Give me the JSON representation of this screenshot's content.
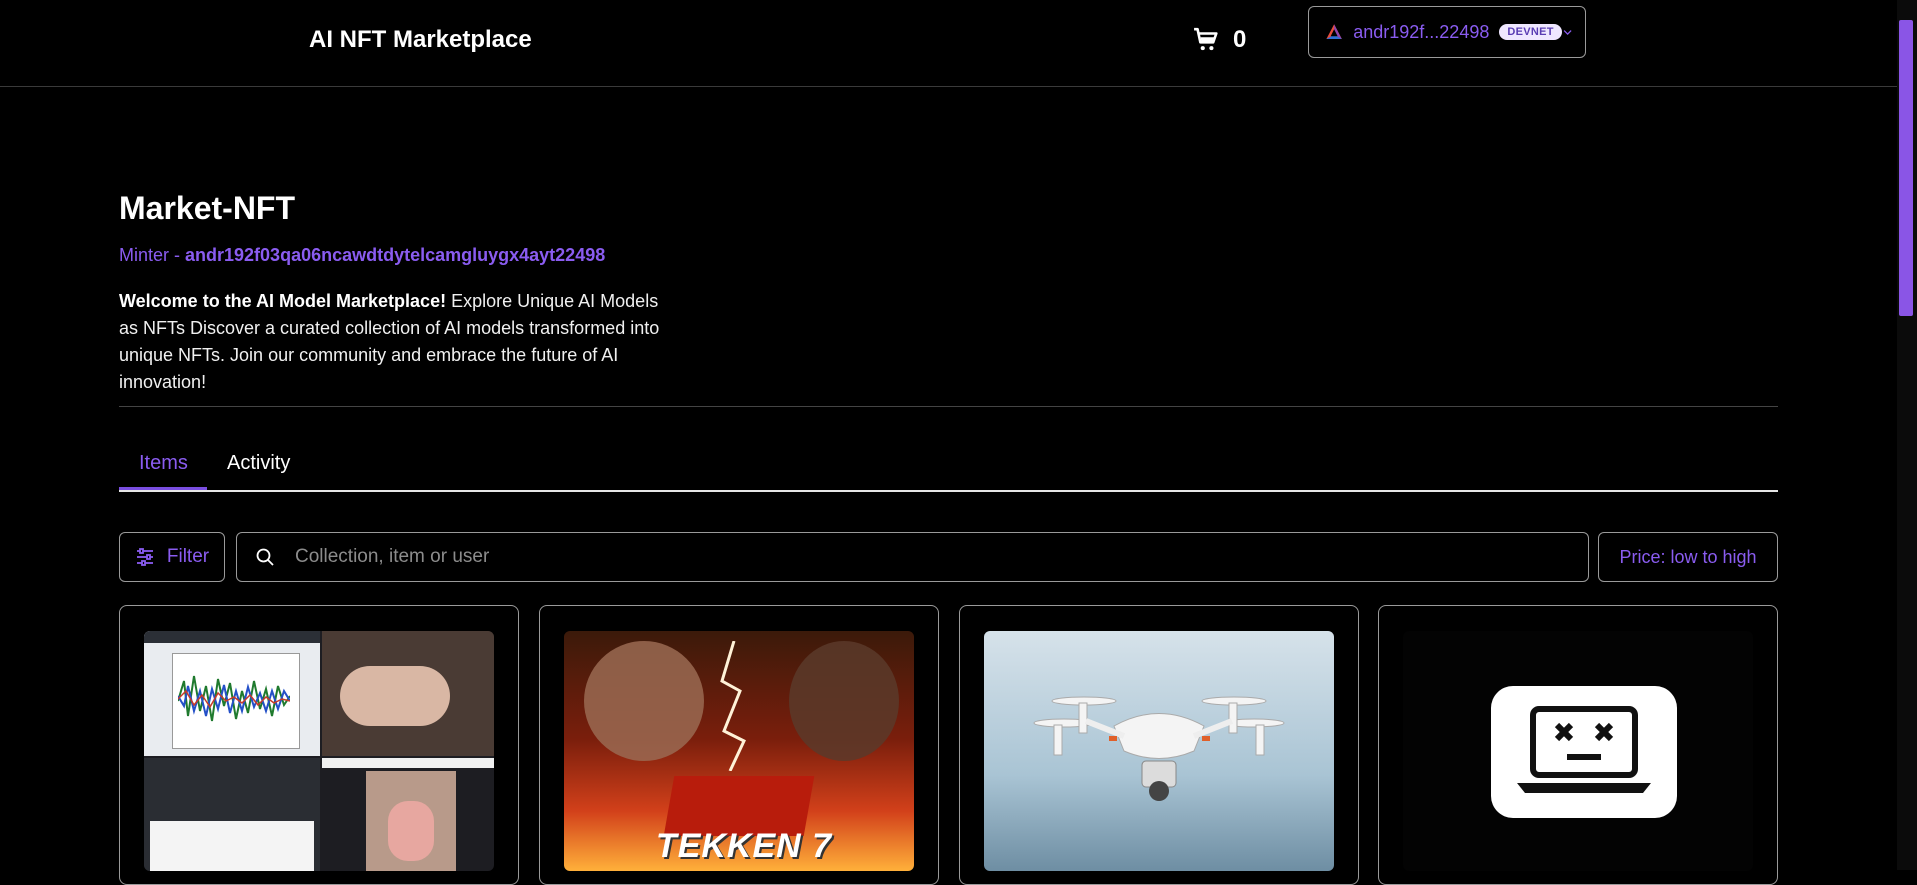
{
  "header": {
    "brand": "AI NFT Marketplace",
    "cart_count": "0",
    "wallet": {
      "address": "andr192f...22498",
      "network_badge": "DEVNET"
    }
  },
  "collection": {
    "title": "Market-NFT",
    "minter_label": "Minter - ",
    "minter_address": "andr192f03qa06ncawdtdytelcamgluygx4ayt22498",
    "description_bold": "Welcome to the AI Model Marketplace!",
    "description_rest": " Explore Unique AI Models as NFTs Discover a curated collection of AI models transformed into unique NFTs. Join our community and embrace the future of AI innovation!"
  },
  "tabs": [
    {
      "label": "Items",
      "active": true
    },
    {
      "label": "Activity",
      "active": false
    }
  ],
  "toolbar": {
    "filter_label": "Filter",
    "search_placeholder": "Collection, item or user",
    "sort_label": "Price: low to high"
  },
  "cards": [
    {
      "image": "screenshot-collage"
    },
    {
      "image": "tekken-7-artwork",
      "image_text": "TEKKEN 7"
    },
    {
      "image": "drone-photo"
    },
    {
      "image": "broken-laptop-icon"
    }
  ],
  "colors": {
    "accent": "#8a5cf0",
    "background": "#000000",
    "border": "#9a9a9a"
  }
}
